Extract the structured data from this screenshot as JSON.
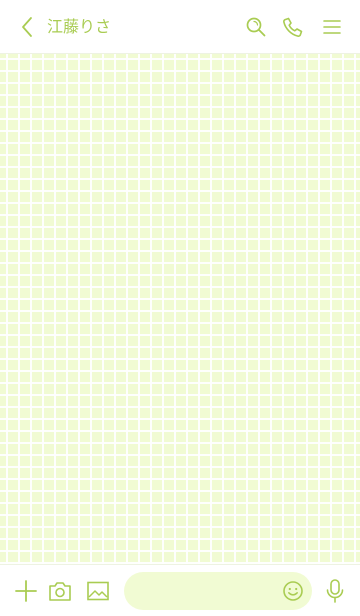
{
  "header": {
    "title": "江藤りさ",
    "back_icon": "chevron-left-icon",
    "search_icon": "search-icon",
    "call_icon": "phone-icon",
    "menu_icon": "hamburger-menu-icon"
  },
  "composer": {
    "add_icon": "plus-icon",
    "camera_icon": "camera-icon",
    "image_icon": "image-icon",
    "input_value": "",
    "emoji_icon": "smiley-icon",
    "mic_icon": "microphone-icon"
  },
  "colors": {
    "accent": "#a9cc52",
    "chat_background": "#f1fbd3",
    "grid_line": "#ffffff",
    "header_background": "#ffffff"
  }
}
